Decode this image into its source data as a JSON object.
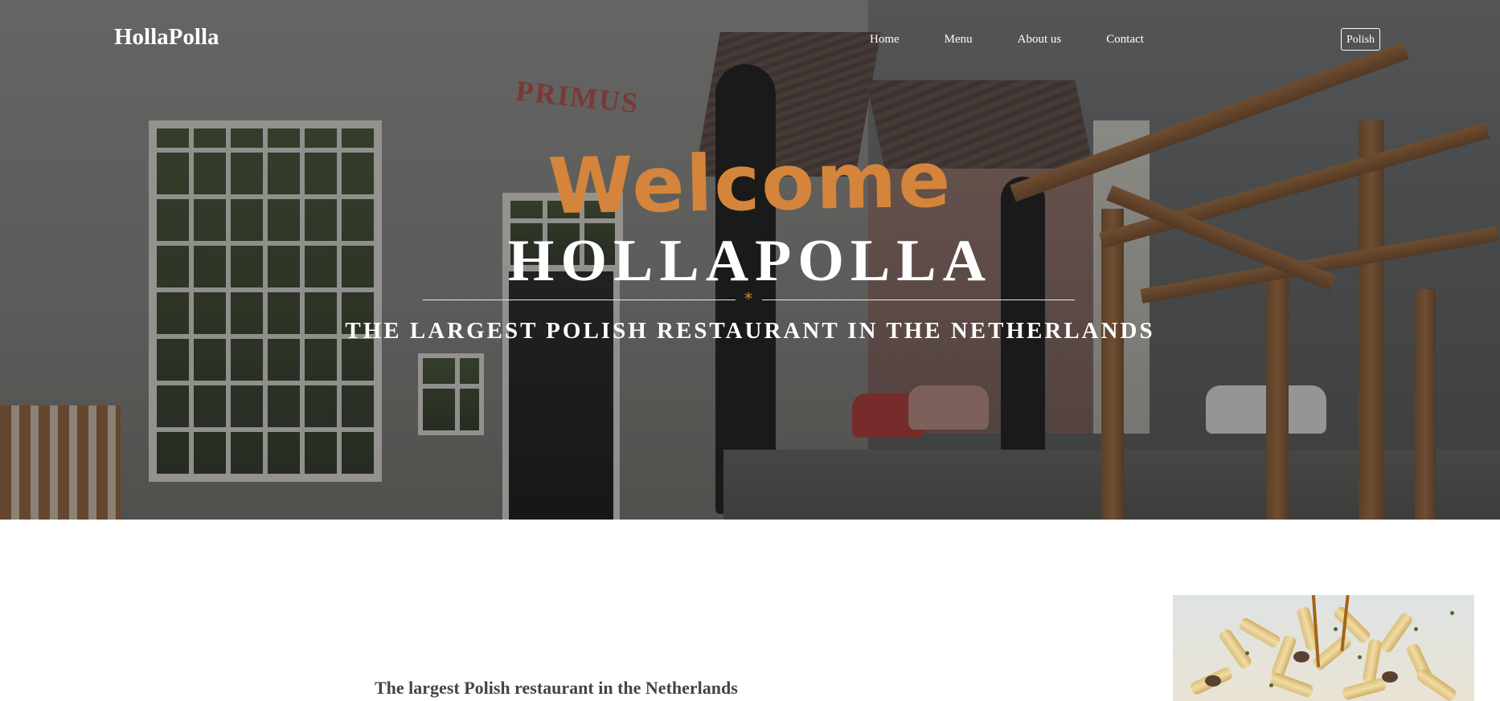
{
  "header": {
    "logo": "HollaPolla",
    "nav": [
      {
        "label": "Home"
      },
      {
        "label": "Menu"
      },
      {
        "label": "About us"
      },
      {
        "label": "Contact"
      }
    ],
    "language_button": "Polish"
  },
  "hero": {
    "welcome": "Welcome",
    "title": "HOLLAPOLLA",
    "divider_symbol": "*",
    "tagline": "THE LARGEST POLISH RESTAURANT IN THE NETHERLANDS",
    "background_sign": "PRIMUS",
    "accent_color": "#d4853b"
  },
  "content": {
    "heading": "The largest Polish restaurant in the Netherlands"
  }
}
